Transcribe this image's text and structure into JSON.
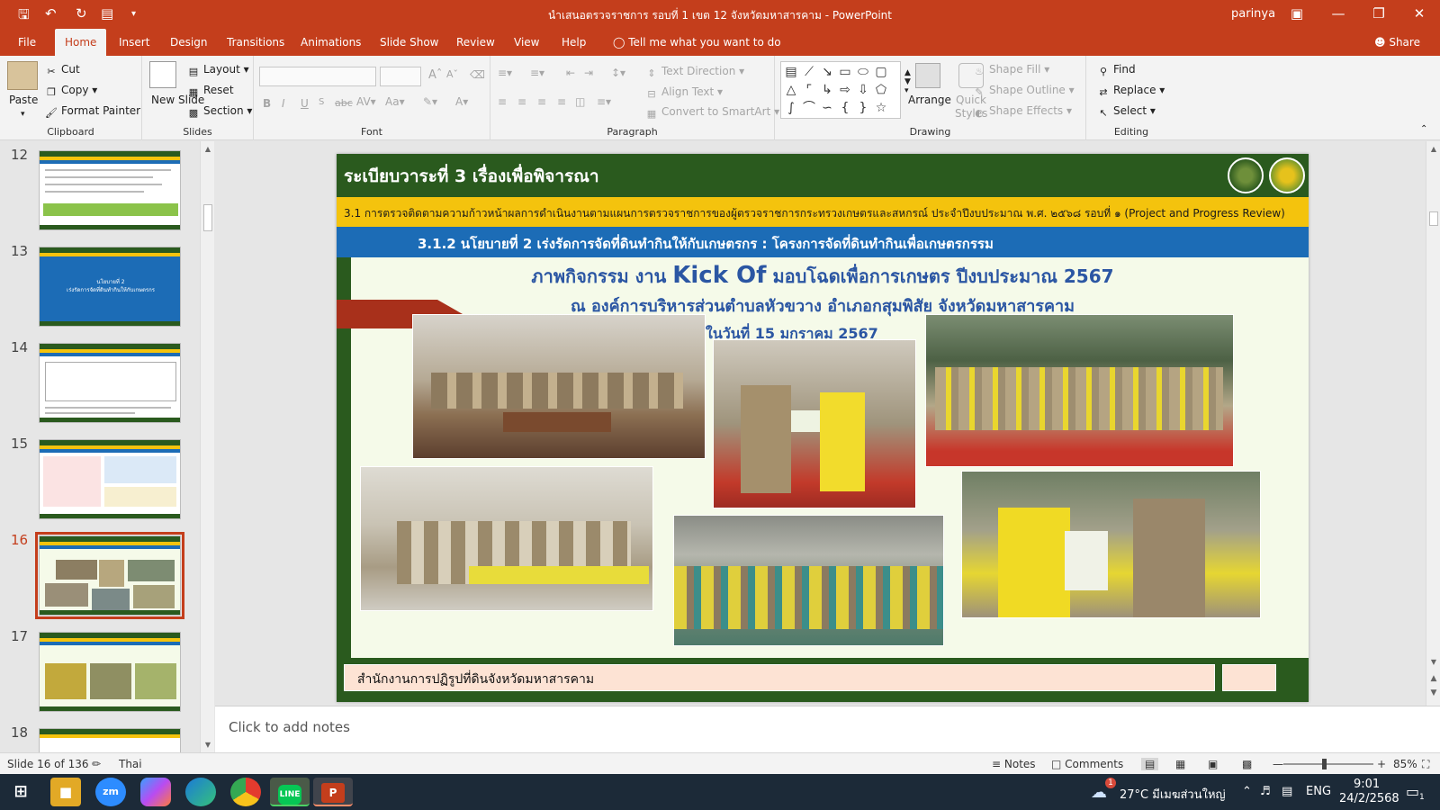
{
  "window": {
    "title": "นำเสนอตรวจราชการ รอบที่ 1 เขต 12 จังหวัดมหาสารคาม  -  PowerPoint",
    "user": "parinya",
    "share": "Share"
  },
  "tabs": [
    "File",
    "Home",
    "Insert",
    "Design",
    "Transitions",
    "Animations",
    "Slide Show",
    "Review",
    "View",
    "Help"
  ],
  "tell_me": "Tell me what you want to do",
  "ribbon": {
    "clipboard": {
      "label": "Clipboard",
      "paste": "Paste",
      "cut": "Cut",
      "copy": "Copy",
      "format_painter": "Format Painter"
    },
    "slides": {
      "label": "Slides",
      "new_slide": "New Slide",
      "layout": "Layout",
      "reset": "Reset",
      "section": "Section"
    },
    "font": {
      "label": "Font",
      "bold": "B",
      "italic": "I",
      "underline": "U",
      "strike": "abc",
      "case": "Aa"
    },
    "paragraph": {
      "label": "Paragraph",
      "text_direction": "Text Direction",
      "align_text": "Align Text",
      "smartart": "Convert to SmartArt"
    },
    "drawing": {
      "label": "Drawing",
      "arrange": "Arrange",
      "quick_styles": "Quick Styles",
      "shape_fill": "Shape Fill",
      "shape_outline": "Shape Outline",
      "shape_effects": "Shape Effects"
    },
    "editing": {
      "label": "Editing",
      "find": "Find",
      "replace": "Replace",
      "select": "Select"
    }
  },
  "thumbnails": [
    {
      "num": "12",
      "style": "table"
    },
    {
      "num": "13",
      "style": "blue",
      "text": "นโยบายที่ 2\nเร่งรัดการจัดที่ดินทำกินให้กับเกษตรกร"
    },
    {
      "num": "14",
      "style": "table"
    },
    {
      "num": "15",
      "style": "mixed"
    },
    {
      "num": "16",
      "style": "photos",
      "selected": true
    },
    {
      "num": "17",
      "style": "photos2"
    },
    {
      "num": "18",
      "style": "partial"
    }
  ],
  "slide": {
    "header": "ระเบียบวาระที่ 3 เรื่องเพื่อพิจารณา",
    "yellow_bar": "3.1 การตรวจติดตามความก้าวหน้าผลการดำเนินงานตามแผนการตรวจราชการของผู้ตรวจราชการกระทรวงเกษตรและสหกรณ์ ประจำปีงบประมาณ พ.ศ. ๒๕๖๘ รอบที่ ๑ (Project and Progress Review)",
    "blue_bar": "3.1.2 นโยบายที่ 2 เร่งรัดการจัดที่ดินทำกินให้กับเกษตรกร : โครงการจัดที่ดินทำกินเพื่อเกษตรกรรม",
    "activity_line1_a": "ภาพกิจกรรม งาน",
    "activity_line1_b": "Kick Of",
    "activity_line1_c": "มอบโฉดเพื่อการเกษตร ปีงบประมาณ 2567",
    "activity_line2": "ณ องค์การบริหารส่วนตำบลหัวขวาง อำเภอกสุมพิสัย จังหวัดมหาสารคาม",
    "activity_date": "ในวันที่ 15 มกราคม 2567",
    "footer": "สำนักงานการปฏิรูปที่ดินจังหวัดมหาสารคาม"
  },
  "notes_placeholder": "Click to add notes",
  "status": {
    "slide_of": "Slide 16 of 136",
    "language": "Thai",
    "notes": "Notes",
    "comments": "Comments",
    "zoom": "85%",
    "zoom_fraction": 0.45
  },
  "taskbar": {
    "weather": "27°C  มีเมฆส่วนใหญ่",
    "lang": "ENG",
    "time": "9:01",
    "date": "24/2/2568",
    "weather_badge": "1",
    "notif_count": "1"
  },
  "colors": {
    "ppt_red": "#c43e1c",
    "slide_green": "#2a5a1e",
    "slide_yellow": "#f4c30d",
    "slide_blue": "#1c6cb6",
    "title_blue": "#2b56a3"
  }
}
